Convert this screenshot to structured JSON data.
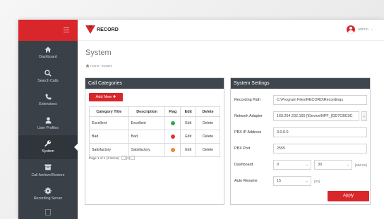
{
  "brand": {
    "name": "RECORD"
  },
  "header": {
    "user": "admin"
  },
  "nav": [
    {
      "label": "Dashboard",
      "icon": "home-icon"
    },
    {
      "label": "Search Calls",
      "icon": "search-icon"
    },
    {
      "label": "Extensions",
      "icon": "phone-icon"
    },
    {
      "label": "User Profiles",
      "icon": "user-icon"
    },
    {
      "label": "System",
      "icon": "wrench-icon"
    },
    {
      "label": "Call Archive/Restore",
      "icon": "archive-icon"
    },
    {
      "label": "Recording Server",
      "icon": "gear-icon"
    }
  ],
  "page": {
    "title": "System",
    "breadcrumb": [
      "Home",
      "System"
    ]
  },
  "categories": {
    "title": "Call Categories",
    "add_label": "Add New",
    "columns": [
      "Category Title",
      "Description",
      "Flag",
      "Edit",
      "Delete"
    ],
    "rows": [
      {
        "title": "Excellent",
        "description": "Excellent",
        "flag_color": "#3aa64a",
        "edit": "Edit",
        "delete": "Delete"
      },
      {
        "title": "Bad",
        "description": "Bad",
        "flag_color": "#e0322f",
        "edit": "Edit",
        "delete": "Delete"
      },
      {
        "title": "Satisfactory",
        "description": "Satisfactory",
        "flag_color": "#f08a24",
        "edit": "Edit",
        "delete": "Delete"
      }
    ],
    "pager": "Page 1 of 1 (3 items)",
    "pager_current": "[1]"
  },
  "settings": {
    "title": "System Settings",
    "recording_path_label": "Recording Path",
    "recording_path": "C:\\Program Files\\RECORD\\Recordings",
    "network_adapter_label": "Network Adapter",
    "network_adapter": "169.254.232.165 [\\Device\\NPF_{DD7CBC9C",
    "pbx_ip_label": "PBX IP Address",
    "pbx_ip": "0.0.0.0",
    "pbx_port_label": "PBX Port",
    "pbx_port": "2555",
    "dashboard_label": "Dashboard",
    "dashboard_min": "0",
    "dashboard_sec": "30",
    "dashboard_unit": "[MM:SS]",
    "auto_resume_label": "Auto Resume",
    "auto_resume": "15",
    "auto_resume_unit": "[SS]",
    "apply_label": "Apply"
  },
  "colors": {
    "accent": "#d9262b",
    "sidebar": "#3a4047",
    "panel_header": "#3f464d"
  }
}
